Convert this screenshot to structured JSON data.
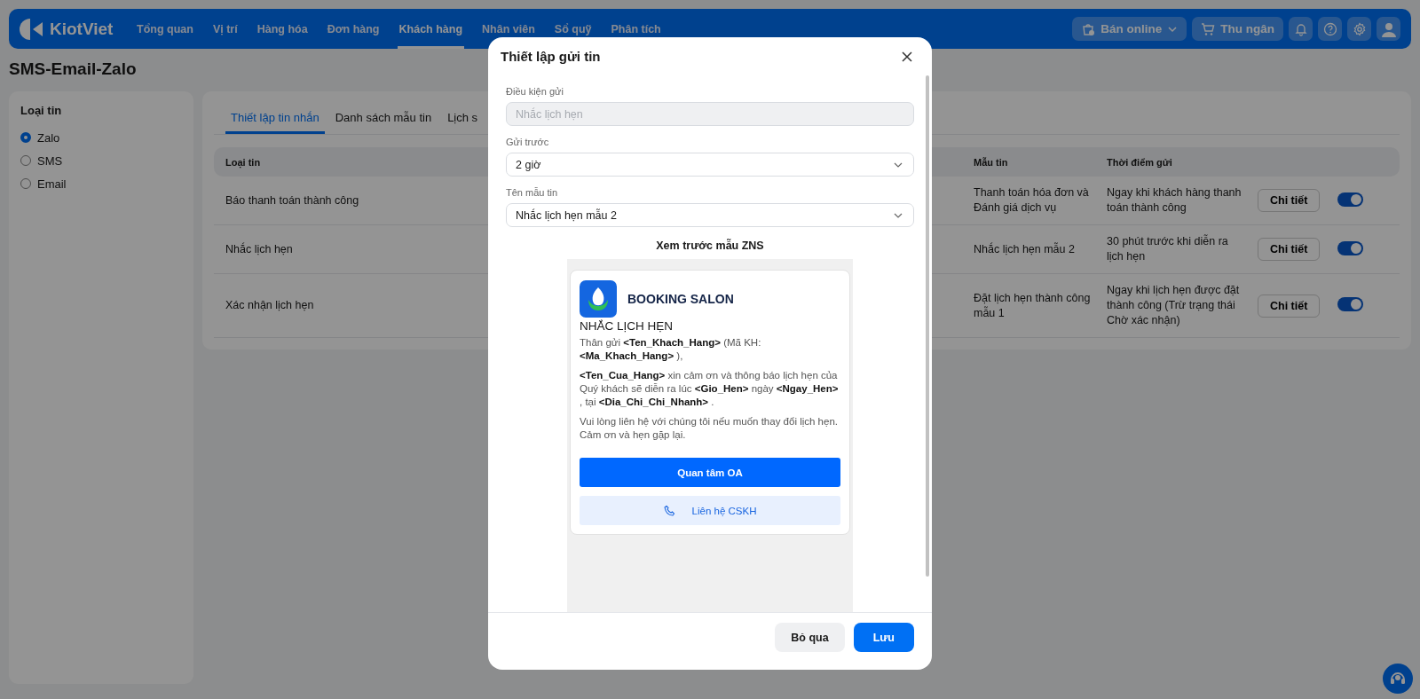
{
  "nav": {
    "logo": "KiotViet",
    "items": [
      {
        "label": "Tổng quan",
        "selected": false
      },
      {
        "label": "Vị trí",
        "selected": false
      },
      {
        "label": "Hàng hóa",
        "selected": false
      },
      {
        "label": "Đơn hàng",
        "selected": false
      },
      {
        "label": "Khách hàng",
        "selected": true
      },
      {
        "label": "Nhân viên",
        "selected": false
      },
      {
        "label": "Sổ quỹ",
        "selected": false
      },
      {
        "label": "Phân tích",
        "selected": false
      }
    ],
    "actions": [
      {
        "kind": "online",
        "label": "Bán online"
      },
      {
        "kind": "cashier",
        "label": "Thu ngân"
      }
    ]
  },
  "page_title": "SMS-Email-Zalo",
  "sidebar": {
    "title": "Loại tin",
    "options": [
      {
        "label": "Zalo",
        "selected": true
      },
      {
        "label": "SMS",
        "selected": false
      },
      {
        "label": "Email",
        "selected": false
      }
    ]
  },
  "tabs": [
    {
      "label": "Thiết lập tin nhắn",
      "selected": true
    },
    {
      "label": "Danh sách mẫu tin",
      "selected": false
    },
    {
      "label": "Lịch s",
      "selected": false
    }
  ],
  "table": {
    "columns": [
      "Loại tin",
      "Mẫu tin",
      "Thời điểm gửi"
    ],
    "rows": [
      {
        "type": "Báo thanh toán thành công",
        "template": "Thanh toán hóa đơn và Đánh giá dịch vụ",
        "send_time": "Ngay khi khách hàng thanh toán thành công",
        "button": "Chi tiết",
        "on": true
      },
      {
        "type": "Nhắc lịch hẹn",
        "template": "Nhắc lịch hẹn mẫu 2",
        "send_time": "30 phút trước khi diễn ra lịch hẹn",
        "button": "Chi tiết",
        "on": true
      },
      {
        "type": "Xác nhận lịch hẹn",
        "template": "Đặt lịch hẹn thành công mẫu 1",
        "send_time": "Ngay khi lịch hẹn được đặt thành công (Trừ trạng thái Chờ xác nhận)",
        "button": "Chi tiết",
        "on": true
      }
    ]
  },
  "modal": {
    "title": "Thiết lập gửi tin",
    "fields": [
      {
        "kind": "text",
        "label": "Điều kiện gửi",
        "value": "Nhắc lịch hẹn",
        "disabled": true
      },
      {
        "kind": "select",
        "label": "Gửi trước",
        "value": "2 giờ",
        "disabled": false
      },
      {
        "kind": "select",
        "label": "Tên mẫu tin",
        "value": "Nhắc lịch hẹn mẫu 2",
        "disabled": false
      }
    ],
    "preview": {
      "title": "Xem trước mẫu ZNS",
      "brand": "BOOKING SALON",
      "heading": "NHẮC LỊCH HẸN",
      "paragraphs": [
        "Thân gửi **<Ten_Khach_Hang>** (Mã KH: **<Ma_Khach_Hang>** ),",
        "**<Ten_Cua_Hang>** xin cảm ơn và thông báo lịch hẹn của Quý khách sẽ diễn ra lúc **<Gio_Hen>** ngày **<Ngay_Hen>** , tại **<Dia_Chi_Chi_Nhanh>** .",
        "Vui lòng liên hệ với chúng tôi nếu muốn thay đổi lịch hẹn. Cảm ơn và hẹn gặp lại."
      ],
      "buttons": [
        {
          "kind": "primary",
          "label": "Quan tâm OA"
        },
        {
          "kind": "contact",
          "label": "Liên hệ CSKH"
        }
      ]
    },
    "buttons": [
      {
        "kind": "secondary",
        "label": "Bỏ qua"
      },
      {
        "kind": "primary",
        "label": "Lưu"
      }
    ]
  }
}
